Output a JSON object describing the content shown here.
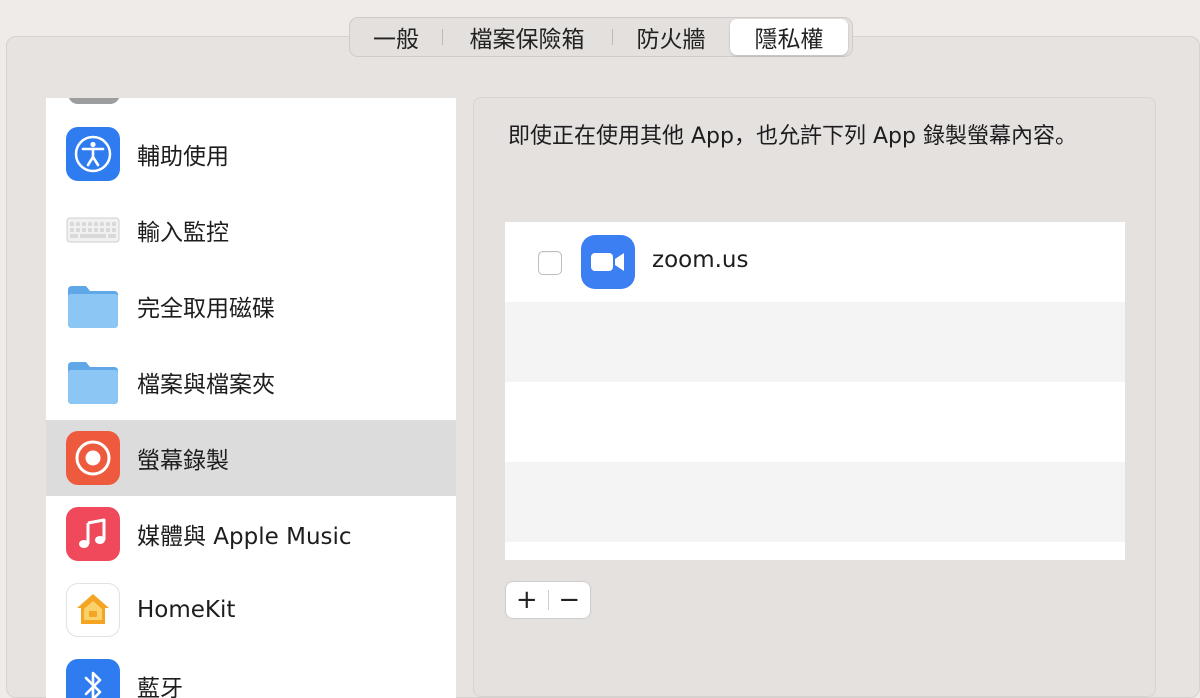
{
  "tabs": [
    {
      "label": "一般",
      "active": false
    },
    {
      "label": "檔案保險箱",
      "active": false
    },
    {
      "label": "防火牆",
      "active": false
    },
    {
      "label": "隱私權",
      "active": true
    }
  ],
  "sidebar": {
    "items": [
      {
        "label": "輔助使用",
        "icon": "accessibility-icon"
      },
      {
        "label": "輸入監控",
        "icon": "keyboard-icon"
      },
      {
        "label": "完全取用磁碟",
        "icon": "folder-icon"
      },
      {
        "label": "檔案與檔案夾",
        "icon": "folder-icon"
      },
      {
        "label": "螢幕錄製",
        "icon": "screen-record-icon",
        "selected": true
      },
      {
        "label": "媒體與 Apple Music",
        "icon": "music-icon"
      },
      {
        "label": "HomeKit",
        "icon": "home-icon"
      },
      {
        "label": "藍牙",
        "icon": "bluetooth-icon"
      }
    ]
  },
  "main": {
    "description": "即使正在使用其他 App，也允許下列 App 錄製螢幕內容。",
    "apps": [
      {
        "name": "zoom.us",
        "checked": false,
        "icon": "zoom-video-icon"
      }
    ],
    "add_label": "+",
    "remove_label": "−"
  },
  "colors": {
    "accent_blue": "#3b7ff2",
    "record_red": "#ee5a3e",
    "music_red": "#f0495c",
    "selected_row": "#dcdcdc"
  }
}
